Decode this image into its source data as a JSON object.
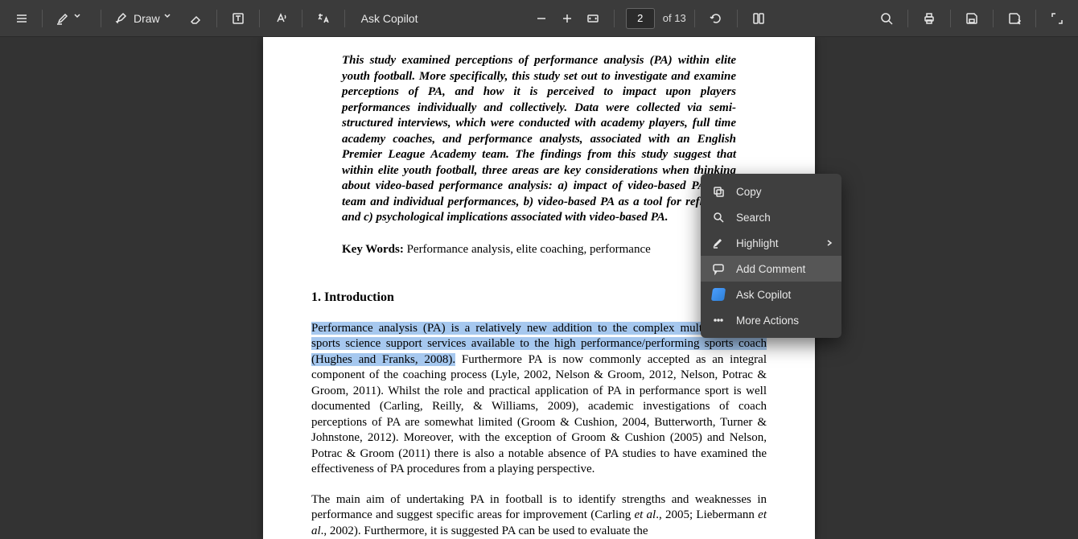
{
  "toolbar": {
    "draw_label": "Draw",
    "ask_copilot_label": "Ask Copilot",
    "page_current": "2",
    "page_total": "of 13"
  },
  "doc": {
    "abstract": "This study examined perceptions of performance analysis (PA) within elite youth football.  More specifically, this study set out to investigate and examine  perceptions of PA, and how it is perceived to impact upon players performances individually and collectively.  Data were collected via semi-structured interviews, which were conducted with academy players, full time academy coaches, and performance analysts, associated with an English Premier League Academy team.  The findings from this study suggest that within elite youth football, three areas are key considerations when thinking about video-based performance analysis: a) impact of video-based PA upon team and individual performances, b) video-based PA as a tool for reflection, and c) psychological implications associated with video-based PA.",
    "keywords_label": "Key Words:",
    "keywords_value": "  Performance analysis, elite coaching, performance",
    "section_heading": "1. Introduction",
    "body1_selected": "Performance analysis (PA) is a relatively new addition to the complex multi-disciplinary sports science support services available to the high performance/performing sports coach (Hughes and Franks, 2008).",
    "body1_rest": "  Furthermore PA is now commonly accepted as an integral component of the coaching process (Lyle, 2002, Nelson & Groom, 2012, Nelson, Potrac & Groom, 2011).   Whilst the role and practical application of PA in performance sport is well documented (Carling, Reilly, & Williams, 2009), academic investigations of coach perceptions of PA are somewhat limited (Groom & Cushion, 2004, Butterworth, Turner & Johnstone, 2012).  Moreover, with the exception of Groom & Cushion (2005) and Nelson, Potrac & Groom (2011) there is also a notable absence of PA studies to have examined the effectiveness of PA procedures from a playing perspective.",
    "body2_a": "The main aim of undertaking PA in football is to identify strengths and weaknesses in performance and suggest specific areas for improvement (Carling ",
    "body2_b": "et al",
    "body2_c": "., 2005; Liebermann ",
    "body2_d": "et al",
    "body2_e": "., 2002).  Furthermore, it is suggested PA can be used to evaluate the"
  },
  "context_menu": {
    "items": [
      {
        "label": "Copy",
        "icon": "copy"
      },
      {
        "label": "Search",
        "icon": "search"
      },
      {
        "label": "Highlight",
        "icon": "highlight",
        "submenu": true
      },
      {
        "label": "Add Comment",
        "icon": "comment",
        "hover": true
      },
      {
        "label": "Ask Copilot",
        "icon": "copilot"
      },
      {
        "label": "More Actions",
        "icon": "more"
      }
    ]
  }
}
